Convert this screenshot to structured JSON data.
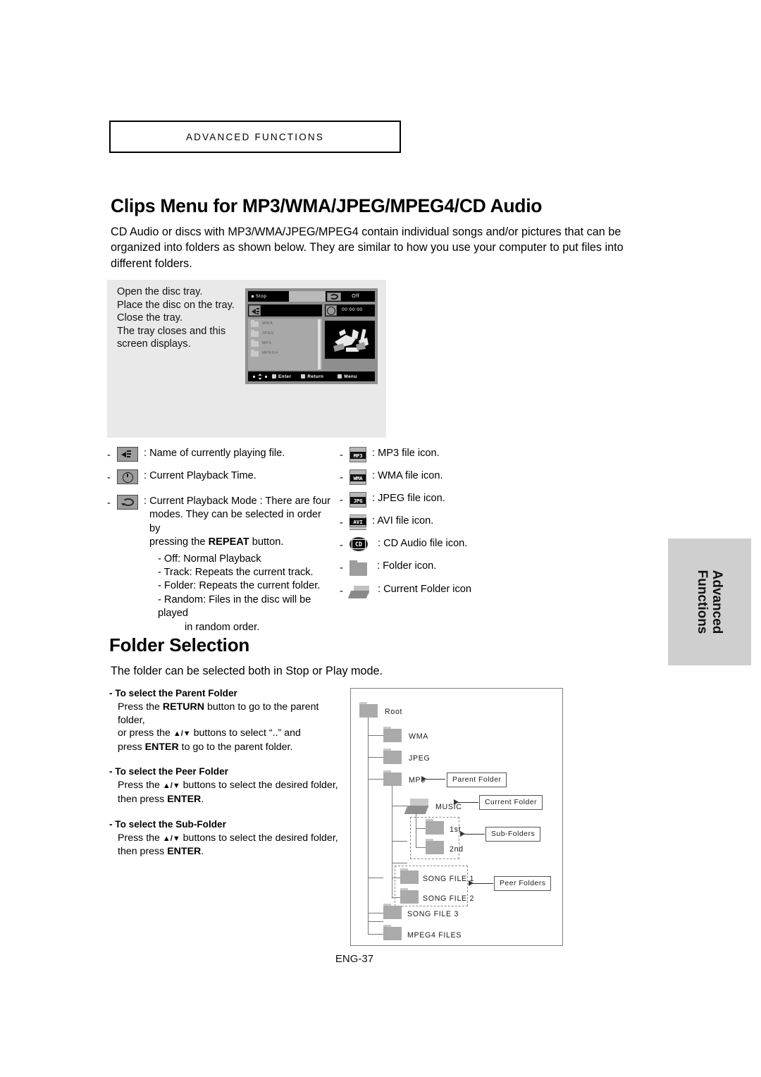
{
  "chapter": {
    "banner": "ADVANCED FUNCTIONS"
  },
  "section1": {
    "title": "Clips Menu for MP3/WMA/JPEG/MPEG4/CD Audio",
    "intro": "CD Audio or discs with MP3/WMA/JPEG/MPEG4 contain individual songs and/or pictures that can be organized into folders as shown below. They are similar to how you use your computer to put files into different folders.",
    "steps": "Open the disc tray.\nPlace the disc on the tray.\nClose the tray.\nThe tray closes and this screen displays."
  },
  "osd": {
    "status": "Stop",
    "repeat_mode": "Off",
    "time": "00:00:00",
    "files": [
      "WMA",
      "JPEG",
      "MP3",
      "MPEG4"
    ],
    "bottom_bar": {
      "nav": "",
      "enter": "Enter",
      "return": "Return",
      "menu": "Menu"
    }
  },
  "legend_left": [
    {
      "icon": "speaker-icon",
      "text": ": Name of currently playing file."
    },
    {
      "icon": "clock-icon",
      "text": ": Current Playback Time."
    },
    {
      "icon": "repeat-icon",
      "text": ": Current Playback Mode : There are four"
    }
  ],
  "playback_mode": {
    "line1": ": Current Playback Mode : There are four",
    "line2": "modes. They can be selected in order by",
    "line3_pre": "pressing the ",
    "line3_b": "REPEAT",
    "line3_post": " button.",
    "items": [
      "- Off: Normal Playback",
      "- Track: Repeats the current track.",
      "- Folder: Repeats the current folder.",
      "- Random: Files in the disc will be played",
      "in random order."
    ]
  },
  "legend_right": [
    {
      "icon": "mp3-file-icon",
      "label": "MP3",
      "text": ": MP3 file icon."
    },
    {
      "icon": "wma-file-icon",
      "label": "WMA",
      "text": ": WMA file icon."
    },
    {
      "icon": "jpeg-file-icon",
      "label": "JPG",
      "text": ": JPEG file icon."
    },
    {
      "icon": "avi-file-icon",
      "label": "AVI",
      "text": ": AVI file icon."
    },
    {
      "icon": "cd-audio-icon",
      "label": "CD",
      "text": ": CD Audio  file icon."
    },
    {
      "icon": "folder-icon",
      "label": "",
      "text": ": Folder icon."
    },
    {
      "icon": "current-folder-icon",
      "label": "",
      "text": ": Current Folder icon"
    }
  ],
  "section2": {
    "title": "Folder Selection",
    "subtitle": "The folder can be selected both in Stop or Play mode.",
    "blocks": [
      {
        "title": "- To select the Parent Folder",
        "l1_a": "Press the ",
        "l1_b": "RETURN",
        "l1_c": " button to go to the parent folder,",
        "l2_a": "or press the ",
        "l2_b": "▲/▼",
        "l2_c": " buttons to select “..” and",
        "l3_a": "press ",
        "l3_b": "ENTER",
        "l3_c": " to go to the parent folder."
      },
      {
        "title": "- To select the Peer Folder",
        "l1_a": "Press the ",
        "l1_b": "▲/▼",
        "l1_c": " buttons to select the desired folder,",
        "l2_a": "then press ",
        "l2_b": "ENTER",
        "l2_c": "."
      },
      {
        "title": "- To select the Sub-Folder",
        "l1_a": "Press the ",
        "l1_b": "▲/▼",
        "l1_c": " buttons to select the desired folder,",
        "l2_a": "then press ",
        "l2_b": "ENTER",
        "l2_c": "."
      }
    ]
  },
  "tree": {
    "nodes": [
      "Root",
      "WMA",
      "JPEG",
      "MP3",
      "MUSIC",
      "1st",
      "2nd",
      "SONG FILE 1",
      "SONG FILE 2",
      "SONG FILE 3",
      "MPEG4 FILES"
    ],
    "callouts": [
      "Parent Folder",
      "Current Folder",
      "Sub-Folders",
      "Peer Folders"
    ]
  },
  "side_tab": {
    "line1": "Advanced",
    "line2": "Functions"
  },
  "footer": {
    "page": "ENG-37"
  }
}
